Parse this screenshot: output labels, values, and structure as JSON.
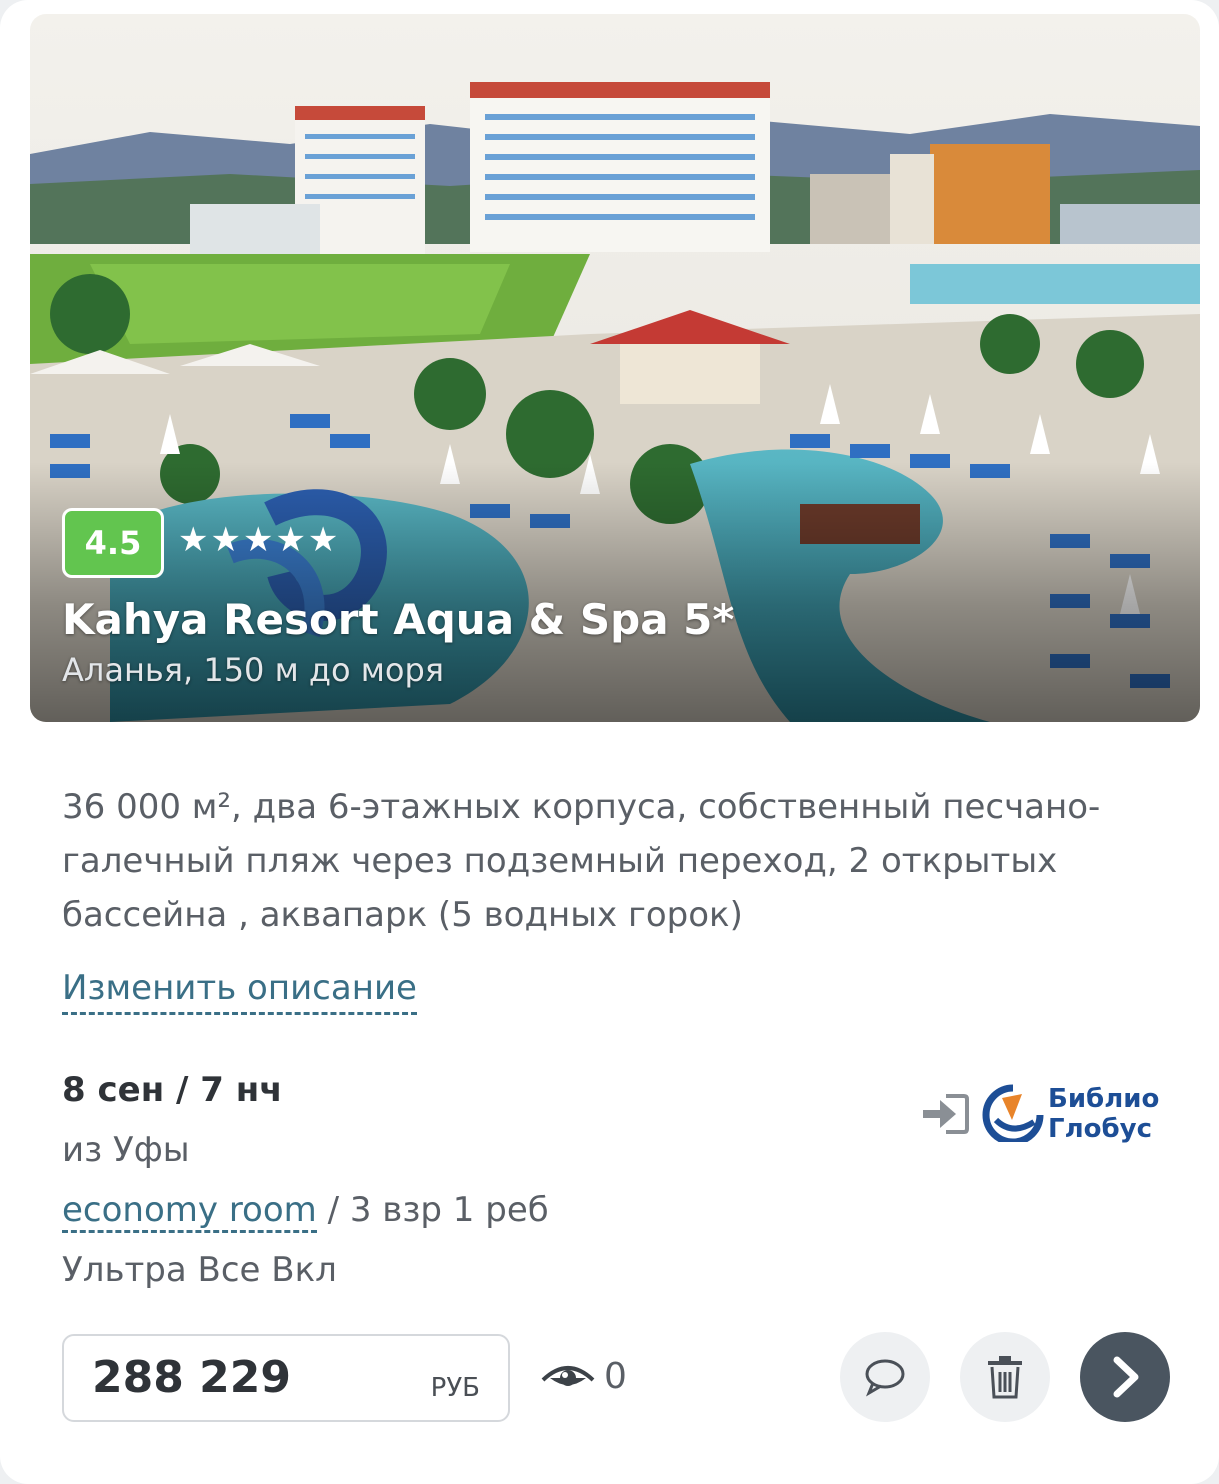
{
  "hotel": {
    "rating": "4.5",
    "stars": "★★★★★",
    "name": "Kahya Resort Aqua & Spa 5*",
    "location": "Аланья, 150 м до моря"
  },
  "description": "36 000 м², два 6-этажных корпуса, собственный песчано-галечный пляж через подземный переход, 2 открытых бассейна , аквапарк (5 водных горок)",
  "edit_description_label": "Изменить описание",
  "tour": {
    "date_nights": "8 сен / 7 нч",
    "departure": "из Уфы",
    "room_type": "economy room",
    "guests": " / 3 взр 1 реб",
    "meal": "Ультра Все Вкл"
  },
  "operator": {
    "line1": "Библио",
    "line2": "Глобус"
  },
  "price": {
    "value": "288 229",
    "currency": "РУБ"
  },
  "views_count": "0",
  "icons": {
    "login": "login-arrow-icon",
    "views": "eye-icon",
    "comment": "speech-bubble-icon",
    "delete": "trash-icon",
    "next": "chevron-right-icon"
  },
  "colors": {
    "rating_badge": "#62c54f",
    "link": "#3a6f86",
    "operator_brand": "#1d4e96",
    "operator_accent": "#e8842a",
    "next_button": "#4a5560"
  }
}
